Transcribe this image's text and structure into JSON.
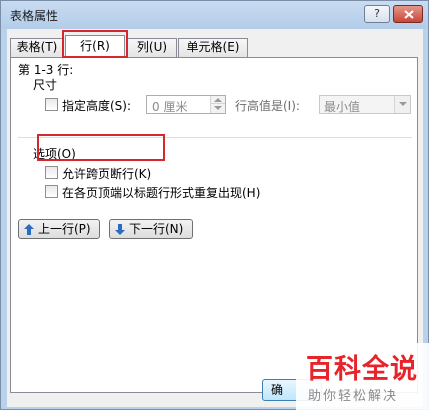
{
  "window": {
    "title": "表格属性",
    "help_label": "?",
    "close_icon": "close-icon"
  },
  "tabs": [
    {
      "label": "表格(T)",
      "active": false
    },
    {
      "label": "行(R)",
      "active": true
    },
    {
      "label": "列(U)",
      "active": false
    },
    {
      "label": "单元格(E)",
      "active": false
    }
  ],
  "row_panel": {
    "rows_label": "第 1-3 行:",
    "size_label": "尺寸",
    "specify_height": {
      "label": "指定高度(S):",
      "checked": false
    },
    "height_value": "0 厘米",
    "row_height_is_label": "行高值是(I):",
    "row_height_mode": "最小值",
    "options_label": "选项(O)",
    "allow_break": {
      "label": "允许跨页断行(K)",
      "checked": false
    },
    "repeat_header": {
      "label": "在各页顶端以标题行形式重复出现(H)",
      "checked": false
    },
    "prev_row_button": "上一行(P)",
    "next_row_button": "下一行(N)"
  },
  "footer": {
    "ok_button": "确"
  },
  "watermark": {
    "main": "百科全说",
    "sub": "助你轻松解决"
  },
  "colors": {
    "highlight_box": "#d6262e",
    "watermark_red": "#e8242b",
    "title_bar": "#b9d1ea"
  }
}
